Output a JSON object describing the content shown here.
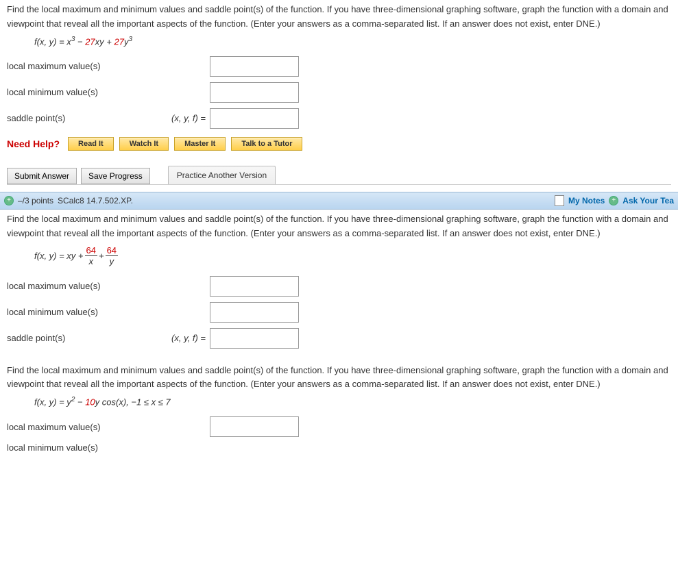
{
  "q1": {
    "prompt": "Find the local maximum and minimum values and saddle point(s) of the function. If you have three-dimensional graphing software, graph the function with a domain and viewpoint that reveal all the important aspects of the function. (Enter your answers as a comma-separated list. If an answer does not exist, enter DNE.)",
    "formula_prefix": "f(x, y) = x",
    "formula_exp1": "3",
    "formula_mid": " − ",
    "formula_red1": "27",
    "formula_mid2": "xy + ",
    "formula_red2": "27",
    "formula_suf": "y",
    "formula_exp2": "3",
    "labels": {
      "localmax": "local maximum value(s)",
      "localmin": "local minimum value(s)",
      "saddle": "saddle point(s)",
      "saddle_mid": "(x, y, f) ="
    }
  },
  "help": {
    "label": "Need Help?",
    "read": "Read It",
    "watch": "Watch It",
    "master": "Master It",
    "talk": "Talk to a Tutor"
  },
  "actions": {
    "submit": "Submit Answer",
    "save": "Save Progress",
    "practice": "Practice Another Version"
  },
  "header": {
    "points": "–/3 points",
    "ref": "SCalc8 14.7.502.XP.",
    "mynotes": "My Notes",
    "ask": "Ask Your Tea"
  },
  "q2": {
    "prompt": "Find the local maximum and minimum values and saddle point(s) of the function. If you have three-dimensional graphing software, graph the function with a domain and viewpoint that reveal all the important aspects of the function. (Enter your answers as a comma-separated list. If an answer does not exist, enter DNE.)",
    "formula_prefix": "f(x, y) = xy + ",
    "frac1_num": "64",
    "frac1_den": "x",
    "formula_mid": " + ",
    "frac2_num": "64",
    "frac2_den": "y",
    "labels": {
      "localmax": "local maximum value(s)",
      "localmin": "local minimum value(s)",
      "saddle": "saddle point(s)",
      "saddle_mid": "(x, y, f) ="
    }
  },
  "q3": {
    "prompt": "Find the local maximum and minimum values and saddle point(s) of the function. If you have three-dimensional graphing software, graph the function with a domain and viewpoint that reveal all the important aspects of the function. (Enter your answers as a comma-separated list. If an answer does not exist, enter DNE.)",
    "formula_prefix": "f(x, y) = y",
    "formula_exp1": "2",
    "formula_mid": " − ",
    "formula_red1": "10",
    "formula_suf": "y cos(x),    −1 ≤ x ≤ 7",
    "labels": {
      "localmax": "local maximum value(s)",
      "localmin": "local minimum value(s)"
    }
  }
}
